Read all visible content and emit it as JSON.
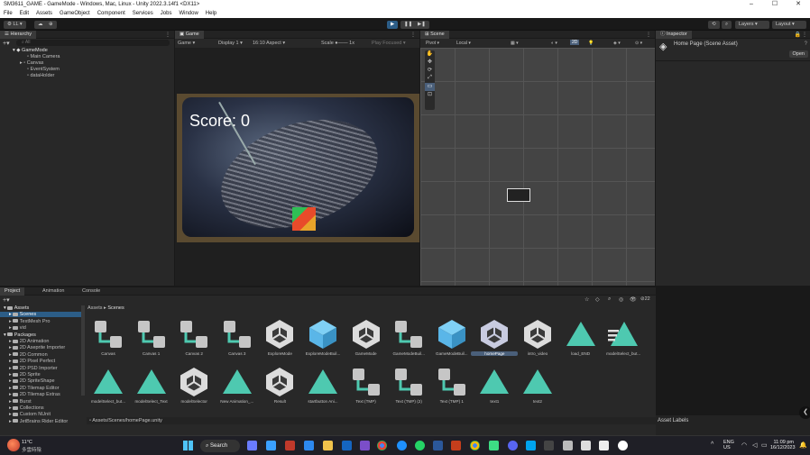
{
  "window": {
    "title": "SM3611_GAME - GameMode - Windows, Mac, Linux - Unity 2022.3.14f1 <DX11>"
  },
  "menu": [
    "File",
    "Edit",
    "Assets",
    "GameObject",
    "Component",
    "Services",
    "Jobs",
    "Window",
    "Help"
  ],
  "toolbar": {
    "account": "LL",
    "layers": "Layers",
    "layout": "Layout"
  },
  "hierarchy": {
    "tab": "Hierarchy",
    "search_hint": "All",
    "scene": "GameMode",
    "items": [
      "Main Camera",
      "Canvas",
      "EventSystem",
      "dataHolder"
    ]
  },
  "game": {
    "tab": "Game",
    "display_mode": "Game",
    "display": "Display 1",
    "aspect": "16:10 Aspect",
    "scale_label": "Scale",
    "scale_value": "1x",
    "play_focused": "Play Focused",
    "score_text": "Score: 0"
  },
  "scene_view": {
    "tab": "Scene",
    "pivot": "Pivot",
    "space": "Local",
    "mode_2d": "2D",
    "gizmo_count": "22"
  },
  "inspector": {
    "tab": "Inspector",
    "asset_title": "Home Page (Scene Asset)",
    "open_button": "Open"
  },
  "bottom_tabs": [
    "Project",
    "Animation",
    "Console"
  ],
  "project_tree": [
    {
      "label": "Assets",
      "level": 0,
      "bold": true
    },
    {
      "label": "Scenes",
      "level": 1,
      "selected": true
    },
    {
      "label": "TextMesh Pro",
      "level": 1
    },
    {
      "label": "vid",
      "level": 1
    },
    {
      "label": "Packages",
      "level": 0,
      "bold": true
    },
    {
      "label": "2D Animation",
      "level": 1
    },
    {
      "label": "2D Aseprite Importer",
      "level": 1
    },
    {
      "label": "2D Common",
      "level": 1
    },
    {
      "label": "2D Pixel Perfect",
      "level": 1
    },
    {
      "label": "2D PSD Importer",
      "level": 1
    },
    {
      "label": "2D Sprite",
      "level": 1
    },
    {
      "label": "2D SpriteShape",
      "level": 1
    },
    {
      "label": "2D Tilemap Editor",
      "level": 1
    },
    {
      "label": "2D Tilemap Extras",
      "level": 1
    },
    {
      "label": "Burst",
      "level": 1
    },
    {
      "label": "Collections",
      "level": 1
    },
    {
      "label": "Custom NUnit",
      "level": 1
    },
    {
      "label": "JetBrains Rider Editor",
      "level": 1
    }
  ],
  "breadcrumb": [
    "Assets",
    "Scenes"
  ],
  "assets_row1": [
    {
      "label": "Canvas",
      "icon": "prefab-icon"
    },
    {
      "label": "Canvas 1",
      "icon": "prefab-icon"
    },
    {
      "label": "Canvas 2",
      "icon": "prefab-icon"
    },
    {
      "label": "Canvas 3",
      "icon": "prefab-icon"
    },
    {
      "label": "ExploreMode",
      "icon": "unity-scene-icon"
    },
    {
      "label": "ExploreModeBuil...",
      "icon": "cube-icon"
    },
    {
      "label": "GameMode",
      "icon": "unity-scene-icon"
    },
    {
      "label": "GameModeBuil...",
      "icon": "prefab-icon"
    },
    {
      "label": "GameModeBuil...",
      "icon": "cube-icon"
    },
    {
      "label": "homePage",
      "icon": "unity-scene-selected-icon",
      "selected": true
    },
    {
      "label": "intro_video",
      "icon": "unity-scene-icon"
    },
    {
      "label": "load_END",
      "icon": "animation-icon"
    },
    {
      "label": "modelSelect_but...",
      "icon": "animation-lines-icon"
    }
  ],
  "assets_row2": [
    {
      "label": "modelSelect_but...",
      "icon": "animation-icon"
    },
    {
      "label": "modelSelect_Text",
      "icon": "animation-icon"
    },
    {
      "label": "modelSelector",
      "icon": "unity-scene-icon"
    },
    {
      "label": "New Animation_...",
      "icon": "animation-icon"
    },
    {
      "label": "Result",
      "icon": "unity-scene-icon"
    },
    {
      "label": "startbutton Ani...",
      "icon": "animation-icon"
    },
    {
      "label": "Text (TMP)",
      "icon": "prefab-icon"
    },
    {
      "label": "Text (TMP) (2)",
      "icon": "prefab-icon"
    },
    {
      "label": "Text (TMP) 1",
      "icon": "prefab-icon"
    },
    {
      "label": "text1",
      "icon": "animation-icon"
    },
    {
      "label": "text2",
      "icon": "animation-icon"
    }
  ],
  "status_path": "Assets/Scenes/homePage.unity",
  "asset_labels": "Asset Labels",
  "taskbar": {
    "weather_temp": "11°C",
    "weather_desc": "多雲時陰",
    "search": "Search",
    "lang": "ENG",
    "region": "US",
    "time": "11:09 pm",
    "date": "16/12/2023"
  },
  "colors": {
    "teal_anim": "#4ec9b0",
    "blue_cube": "#5ab6e8",
    "selection": "#2c5d87"
  }
}
